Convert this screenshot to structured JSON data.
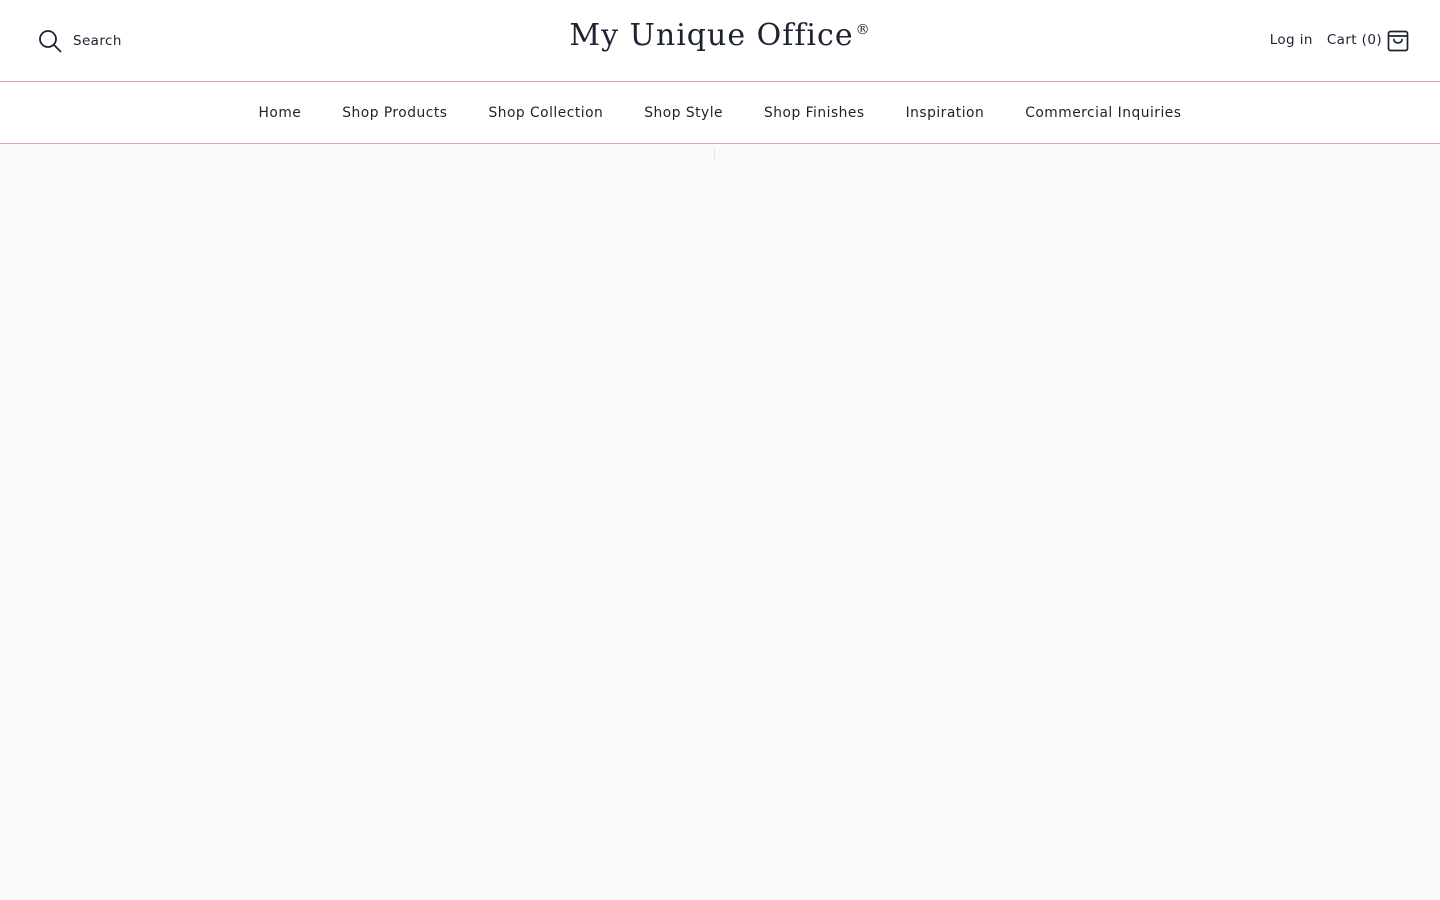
{
  "header": {
    "search_label": "Search",
    "logo_text": "My Unique Office",
    "logo_mark": "®",
    "login_label": "Log in",
    "cart_label": "Cart (0)",
    "icons": {
      "search": "search-icon",
      "cart": "shopping-bag-icon"
    }
  },
  "nav": {
    "items": [
      {
        "label": "Home"
      },
      {
        "label": "Shop Products"
      },
      {
        "label": "Shop Collection"
      },
      {
        "label": "Shop Style"
      },
      {
        "label": "Shop Finishes"
      },
      {
        "label": "Inspiration"
      },
      {
        "label": "Commercial Inquiries"
      }
    ]
  },
  "colors": {
    "text": "#1c2230",
    "divider": "#e4a6a6",
    "page_background": "#f9fafa",
    "header_background": "#ffffff"
  }
}
